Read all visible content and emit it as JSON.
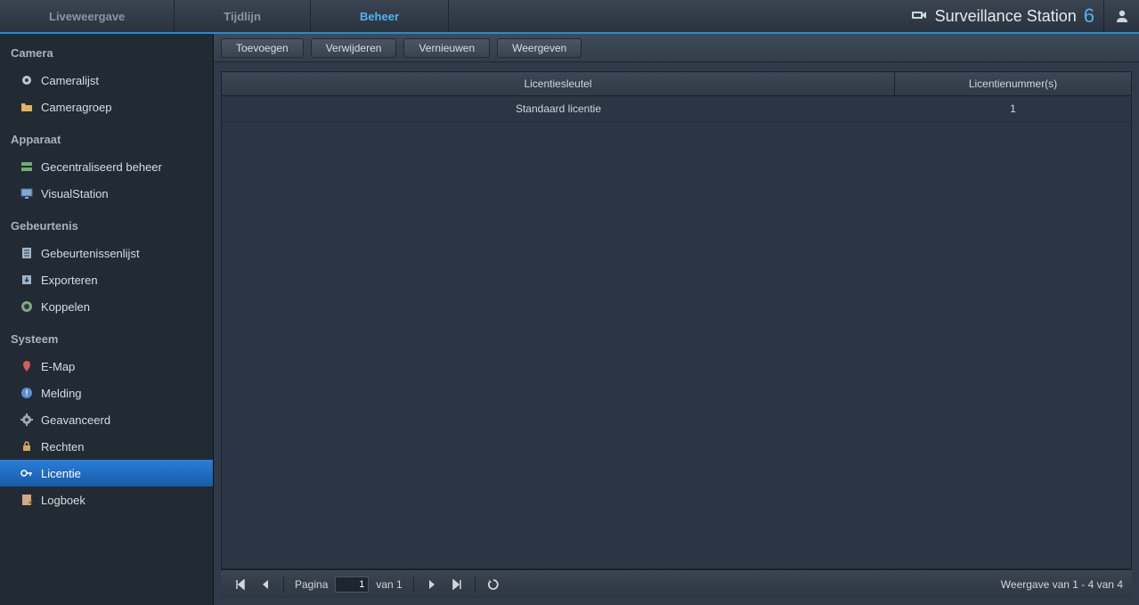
{
  "topbar": {
    "tabs": [
      {
        "label": "Liveweergave",
        "active": false
      },
      {
        "label": "Tijdlijn",
        "active": false
      },
      {
        "label": "Beheer",
        "active": true
      }
    ],
    "brand_prefix": "Surveillance Station",
    "brand_version": "6"
  },
  "sidebar": {
    "sections": [
      {
        "title": "Camera",
        "items": [
          {
            "label": "Cameralijst",
            "icon": "camera-icon",
            "selected": false
          },
          {
            "label": "Cameragroep",
            "icon": "folder-icon",
            "selected": false
          }
        ]
      },
      {
        "title": "Apparaat",
        "items": [
          {
            "label": "Gecentraliseerd beheer",
            "icon": "server-icon",
            "selected": false
          },
          {
            "label": "VisualStation",
            "icon": "monitor-icon",
            "selected": false
          }
        ]
      },
      {
        "title": "Gebeurtenis",
        "items": [
          {
            "label": "Gebeurtenissenlijst",
            "icon": "list-icon",
            "selected": false
          },
          {
            "label": "Exporteren",
            "icon": "export-icon",
            "selected": false
          },
          {
            "label": "Koppelen",
            "icon": "link-icon",
            "selected": false
          }
        ]
      },
      {
        "title": "Systeem",
        "items": [
          {
            "label": "E-Map",
            "icon": "pin-icon",
            "selected": false
          },
          {
            "label": "Melding",
            "icon": "alert-icon",
            "selected": false
          },
          {
            "label": "Geavanceerd",
            "icon": "gear-icon",
            "selected": false
          },
          {
            "label": "Rechten",
            "icon": "lock-icon",
            "selected": false
          },
          {
            "label": "Licentie",
            "icon": "key-icon",
            "selected": true
          },
          {
            "label": "Logboek",
            "icon": "log-icon",
            "selected": false
          }
        ]
      }
    ]
  },
  "toolbar": {
    "buttons": [
      {
        "label": "Toevoegen"
      },
      {
        "label": "Verwijderen"
      },
      {
        "label": "Vernieuwen"
      },
      {
        "label": "Weergeven"
      }
    ]
  },
  "grid": {
    "columns": [
      {
        "label": "Licentiesleutel"
      },
      {
        "label": "Licentienummer(s)"
      }
    ],
    "rows": [
      {
        "key": "Standaard licentie",
        "num": "1"
      }
    ]
  },
  "pager": {
    "page_label": "Pagina",
    "page_value": "1",
    "of_label": "van 1",
    "display_info": "Weergave van 1 - 4 van 4"
  }
}
